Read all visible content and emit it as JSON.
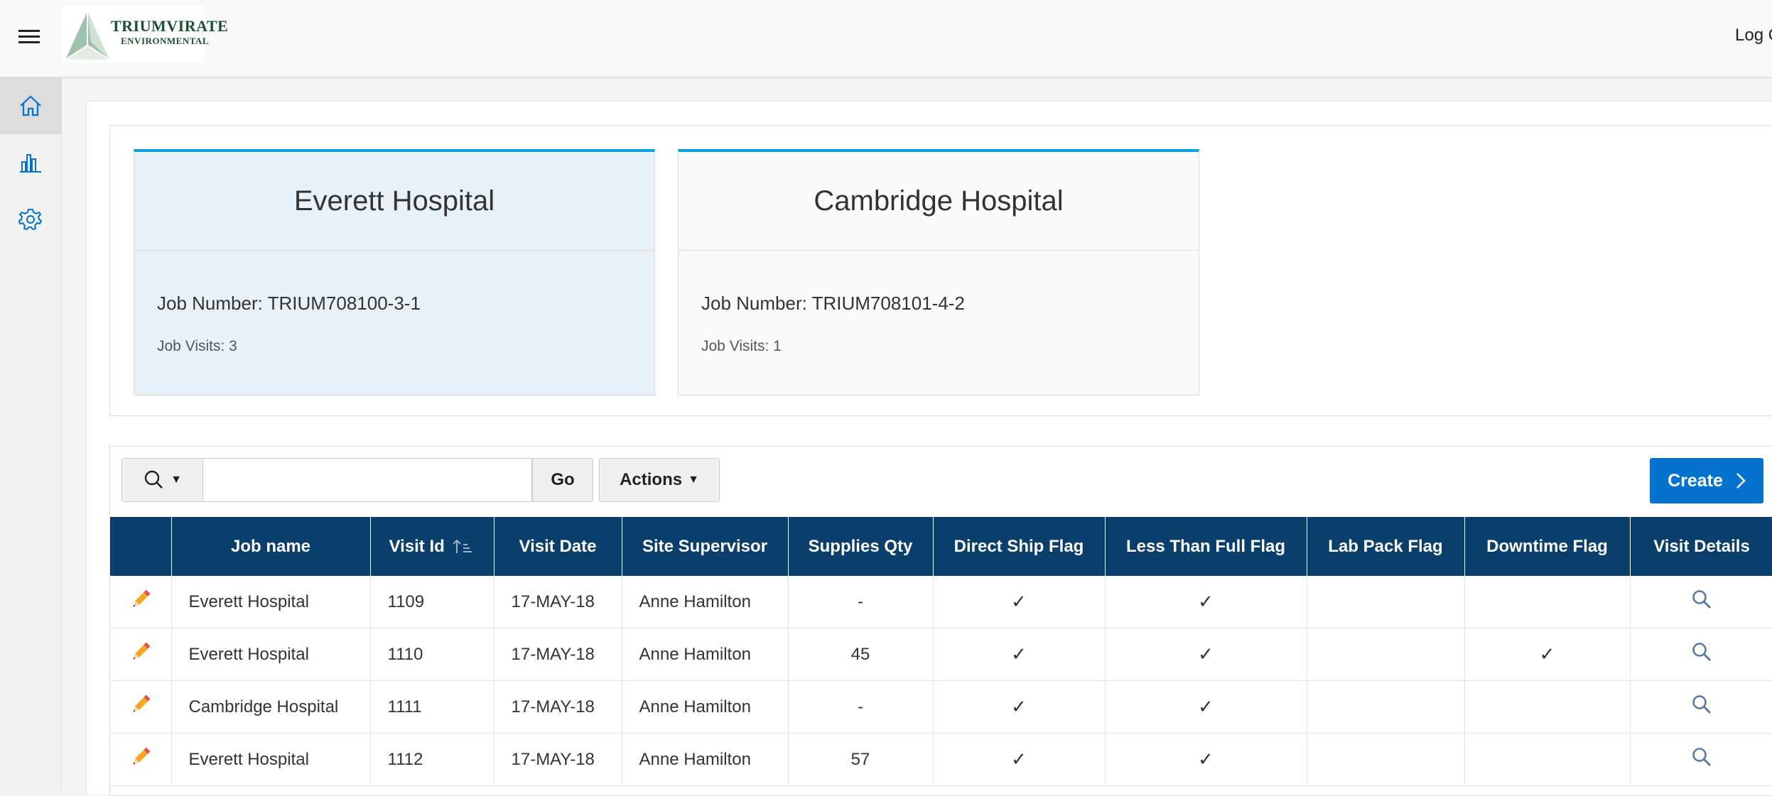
{
  "header": {
    "logo": {
      "line1": "Triumvirate",
      "line2": "Environmental"
    },
    "logout_label": "Log Out"
  },
  "sidebar": {
    "items": [
      {
        "icon": "home-icon",
        "label": "Home",
        "active": true
      },
      {
        "icon": "bar-chart-icon",
        "label": "Reports",
        "active": false
      },
      {
        "icon": "gear-icon",
        "label": "Settings",
        "active": false
      }
    ]
  },
  "cards": [
    {
      "title": "Everett Hospital",
      "job_number": "Job Number: TRIUM708100-3-1",
      "job_visits": "Job Visits: 3",
      "selected": true
    },
    {
      "title": "Cambridge Hospital",
      "job_number": "Job Number: TRIUM708101-4-2",
      "job_visits": "Job Visits: 1",
      "selected": false
    }
  ],
  "toolbar": {
    "search_placeholder": "",
    "go_label": "Go",
    "actions_label": "Actions",
    "create_label": "Create"
  },
  "table": {
    "columns": [
      "",
      "Job name",
      "Visit Id",
      "Visit Date",
      "Site Supervisor",
      "Supplies Qty",
      "Direct Ship Flag",
      "Less Than Full Flag",
      "Lab Pack Flag",
      "Downtime Flag",
      "Visit Details"
    ],
    "rows": [
      {
        "job_name": "Everett Hospital",
        "visit_id": "1109",
        "visit_date": "17-MAY-18",
        "site_supervisor": "Anne Hamilton",
        "supplies_qty": "-",
        "direct_ship": true,
        "less_than_full": true,
        "lab_pack": false,
        "downtime": false
      },
      {
        "job_name": "Everett Hospital",
        "visit_id": "1110",
        "visit_date": "17-MAY-18",
        "site_supervisor": "Anne Hamilton",
        "supplies_qty": "45",
        "direct_ship": true,
        "less_than_full": true,
        "lab_pack": false,
        "downtime": true
      },
      {
        "job_name": "Cambridge Hospital",
        "visit_id": "1111",
        "visit_date": "17-MAY-18",
        "site_supervisor": "Anne Hamilton",
        "supplies_qty": "-",
        "direct_ship": true,
        "less_than_full": true,
        "lab_pack": false,
        "downtime": false
      },
      {
        "job_name": "Everett Hospital",
        "visit_id": "1112",
        "visit_date": "17-MAY-18",
        "site_supervisor": "Anne Hamilton",
        "supplies_qty": "57",
        "direct_ship": true,
        "less_than_full": true,
        "lab_pack": false,
        "downtime": false
      }
    ]
  },
  "colors": {
    "header_bg": "#0b3f6b",
    "accent": "#0572ce",
    "card_top": "#0aa3d6",
    "card_selected_bg": "#e8f1f8"
  }
}
